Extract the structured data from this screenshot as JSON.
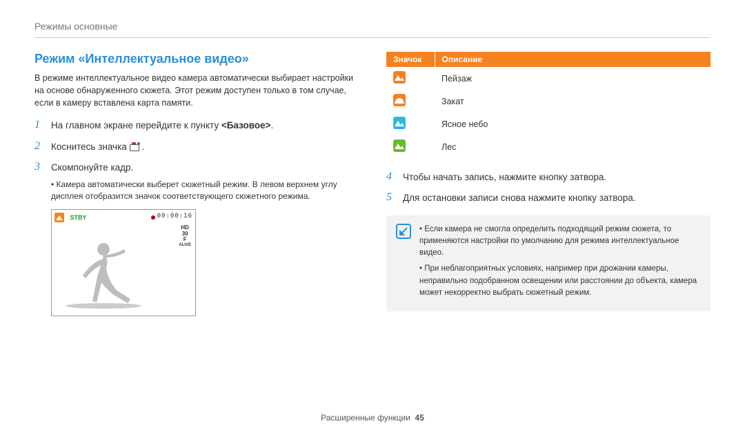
{
  "chapter": "Режимы основные",
  "section_title": "Режим «Интеллектуальное видео»",
  "intro": "В режиме интеллектуальное видео камера автоматически выбирает настройки на основе обнаруженного сюжета. Этот режим доступен только в том случае, если в камеру вставлена карта памяти.",
  "steps": {
    "s1_pre": "На главном экране перейдите к пункту ",
    "s1_bold": "<Базовое>",
    "s1_post": ".",
    "s2_pre": "Коснитесь значка ",
    "s2_post": ".",
    "s3": "Скомпонуйте кадр.",
    "s3_sub": "Камера автоматически выберет сюжетный режим. В левом верхнем углу дисплея отобразится значок соответствующего сюжетного режима.",
    "s4": "Чтобы начать запись, нажмите кнопку затвора.",
    "s5": "Для остановки записи снова нажмите кнопку затвора."
  },
  "screenshot": {
    "stby": "STBY",
    "time": "00:00:16",
    "hd": "HD",
    "fps": "30",
    "f": "F",
    "alive": "ALIVE"
  },
  "table": {
    "head_icon": "Значок",
    "head_desc": "Описание",
    "rows": [
      {
        "icon_name": "landscape-icon",
        "color": "orange",
        "label": "Пейзаж"
      },
      {
        "icon_name": "sunset-icon",
        "color": "orange",
        "label": "Закат"
      },
      {
        "icon_name": "clearsky-icon",
        "color": "cyan",
        "label": "Ясное небо"
      },
      {
        "icon_name": "forest-icon",
        "color": "green",
        "label": "Лес"
      }
    ]
  },
  "note": {
    "n1": "Если камера не смогла определить подходящий режим сюжета, то применяются настройки по умолчанию для режима интеллектуальное видео.",
    "n2": "При неблагоприятных условиях, например при дрожании камеры, неправильно подобранном освещении или расстоянии до объекта, камера может некорректно выбрать сюжетный режим."
  },
  "footer_label": "Расширенные функции",
  "footer_page": "45"
}
